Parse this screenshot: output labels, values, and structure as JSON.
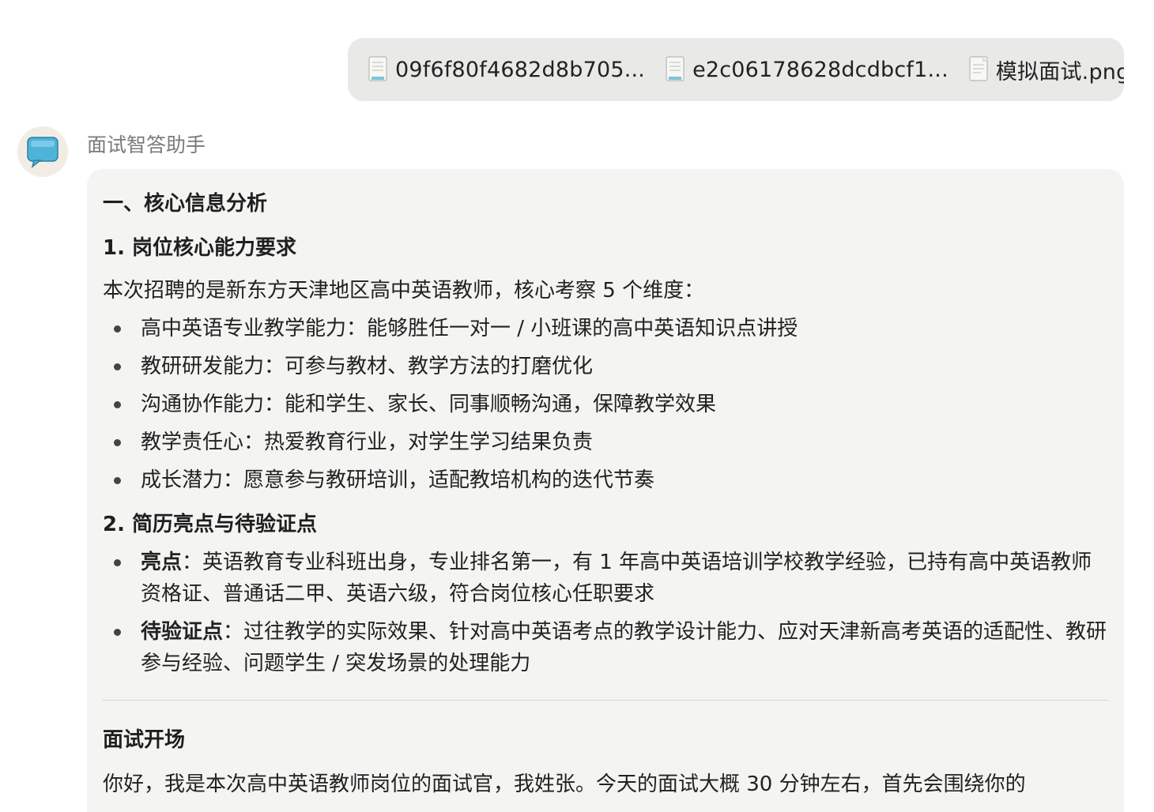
{
  "attachments": [
    {
      "name": "09f6f80f4682d8b705...",
      "icon": "document-icon"
    },
    {
      "name": "e2c06178628dcdbcf1...",
      "icon": "document-icon"
    },
    {
      "name": "模拟面试.png",
      "icon": "image-file-icon"
    }
  ],
  "assistant": {
    "name": "面试智答助手",
    "avatar_icon": "chat-bubble-icon",
    "accent_color": "#4fb3d9"
  },
  "answer": {
    "heading1": "一、核心信息分析",
    "section1": {
      "title": "1. 岗位核心能力要求",
      "intro": "本次招聘的是新东方天津地区高中英语教师，核心考察 5 个维度：",
      "items": [
        "高中英语专业教学能力：能够胜任一对一 / 小班课的高中英语知识点讲授",
        "教研研发能力：可参与教材、教学方法的打磨优化",
        "沟通协作能力：能和学生、家长、同事顺畅沟通，保障教学效果",
        "教学责任心：热爱教育行业，对学生学习结果负责",
        "成长潜力：愿意参与教研培训，适配教培机构的迭代节奏"
      ]
    },
    "section2": {
      "title": "2. 简历亮点与待验证点",
      "items": [
        {
          "label": "亮点",
          "text": "：英语教育专业科班出身，专业排名第一，有 1 年高中英语培训学校教学经验，已持有高中英语教师资格证、普通话二甲、英语六级，符合岗位核心任职要求"
        },
        {
          "label": "待验证点",
          "text": "：过往教学的实际效果、针对高中英语考点的教学设计能力、应对天津新高考英语的适配性、教研参与经验、问题学生 / 突发场景的处理能力"
        }
      ]
    },
    "opening": {
      "title": "面试开场",
      "text": "你好，我是本次高中英语教师岗位的面试官，我姓张。今天的面试大概 30 分钟左右，首先会围绕你的"
    }
  }
}
